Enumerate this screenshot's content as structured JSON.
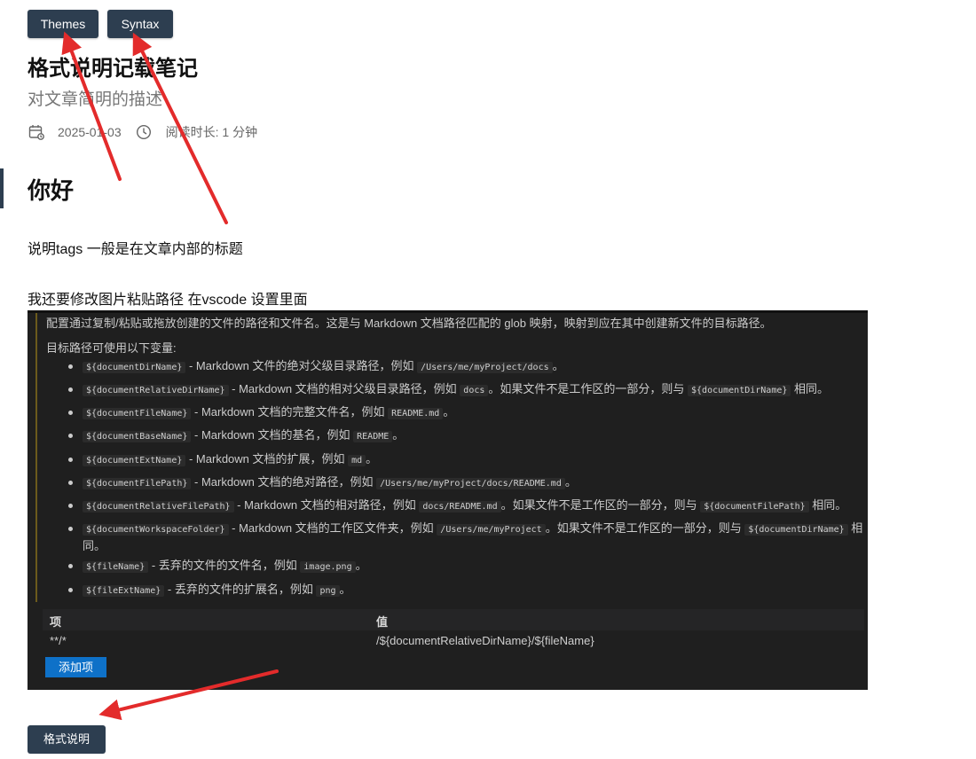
{
  "tags": {
    "themes": "Themes",
    "syntax": "Syntax"
  },
  "post": {
    "title": "格式说明记载笔记",
    "description": "对文章简明的描述",
    "date": "2025-01-03",
    "reading_time": "阅读时长: 1 分钟"
  },
  "content": {
    "heading": "你好",
    "para1": "说明tags 一般是在文章内部的标题",
    "para2": "我还要修改图片粘贴路径 在vscode 设置里面"
  },
  "screenshot": {
    "intro": "配置通过复制/粘贴或拖放创建的文件的路径和文件名。这是与 Markdown 文档路径匹配的 glob 映射，映射到应在其中创建新文件的目标路径。",
    "vars_label": "目标路径可使用以下变量:",
    "vars": [
      {
        "name": "${documentDirName}",
        "t1": " - Markdown 文件的绝对父级目录路径，例如 ",
        "c1": "/Users/me/myProject/docs",
        "t2": "。",
        "c2": "",
        "t3": ""
      },
      {
        "name": "${documentRelativeDirName}",
        "t1": " - Markdown 文档的相对父级目录路径，例如 ",
        "c1": "docs",
        "t2": "。如果文件不是工作区的一部分，则与 ",
        "c2": "${documentDirName}",
        "t3": " 相同。"
      },
      {
        "name": "${documentFileName}",
        "t1": " - Markdown 文档的完整文件名，例如 ",
        "c1": "README.md",
        "t2": "。",
        "c2": "",
        "t3": ""
      },
      {
        "name": "${documentBaseName}",
        "t1": " - Markdown 文档的基名，例如 ",
        "c1": "README",
        "t2": "。",
        "c2": "",
        "t3": ""
      },
      {
        "name": "${documentExtName}",
        "t1": " - Markdown 文档的扩展，例如 ",
        "c1": "md",
        "t2": "。",
        "c2": "",
        "t3": ""
      },
      {
        "name": "${documentFilePath}",
        "t1": " - Markdown 文档的绝对路径，例如 ",
        "c1": "/Users/me/myProject/docs/README.md",
        "t2": "。",
        "c2": "",
        "t3": ""
      },
      {
        "name": "${documentRelativeFilePath}",
        "t1": " - Markdown 文档的相对路径，例如 ",
        "c1": "docs/README.md",
        "t2": "。如果文件不是工作区的一部分，则与 ",
        "c2": "${documentFilePath}",
        "t3": " 相同。"
      },
      {
        "name": "${documentWorkspaceFolder}",
        "t1": " - Markdown 文档的工作区文件夹，例如 ",
        "c1": "/Users/me/myProject",
        "t2": "。如果文件不是工作区的一部分，则与 ",
        "c2": "${documentDirName}",
        "t3": " 相同。"
      },
      {
        "name": "${fileName}",
        "t1": " - 丢弃的文件的文件名，例如 ",
        "c1": "image.png",
        "t2": "。",
        "c2": "",
        "t3": ""
      },
      {
        "name": "${fileExtName}",
        "t1": " - 丢弃的文件的扩展名，例如 ",
        "c1": "png",
        "t2": "。",
        "c2": "",
        "t3": ""
      }
    ],
    "table_headers": {
      "key": "项",
      "value": "值"
    },
    "table_row": {
      "key": "**/*",
      "value": "/${documentRelativeDirName}/${fileName}"
    },
    "add_button": "添加项"
  },
  "footer_tag": "格式说明",
  "colors": {
    "button_bg": "#2d3e50",
    "annotation_arrow": "#e32b2b",
    "vscode_bg": "#1f1f1f",
    "vscode_button": "#0e71c8"
  }
}
